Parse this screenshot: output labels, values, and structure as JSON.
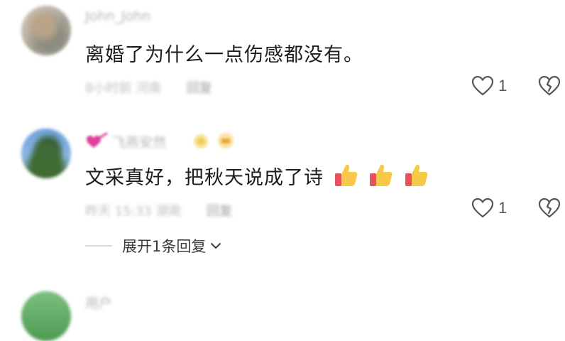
{
  "comments": [
    {
      "username": "John_John",
      "text": "离婚了为什么一点伤感都没有。",
      "meta_time": "8小时前",
      "meta_location": "河南",
      "reply_label": "回复",
      "likes": "1",
      "like_icon": "heart-outline-icon",
      "dislike_icon": "broken-heart-icon"
    },
    {
      "username": "飞燕安然",
      "text": "文采真好，把秋天说成了诗",
      "emoji": [
        "thumbs-up",
        "thumbs-up",
        "thumbs-up"
      ],
      "meta_time": "昨天 15:33",
      "meta_location": "湖南",
      "reply_label": "回复",
      "likes": "1",
      "like_icon": "heart-outline-icon",
      "dislike_icon": "broken-heart-icon",
      "expand_label": "展开1条回复"
    },
    {
      "username": "用户"
    }
  ],
  "colors": {
    "text": "#1c1c1c",
    "muted": "#b5b5b5",
    "icon": "#555555",
    "thumb": "#f7c948",
    "thumb_cuff": "#e8505b",
    "badge_pink": "#e0409a"
  }
}
